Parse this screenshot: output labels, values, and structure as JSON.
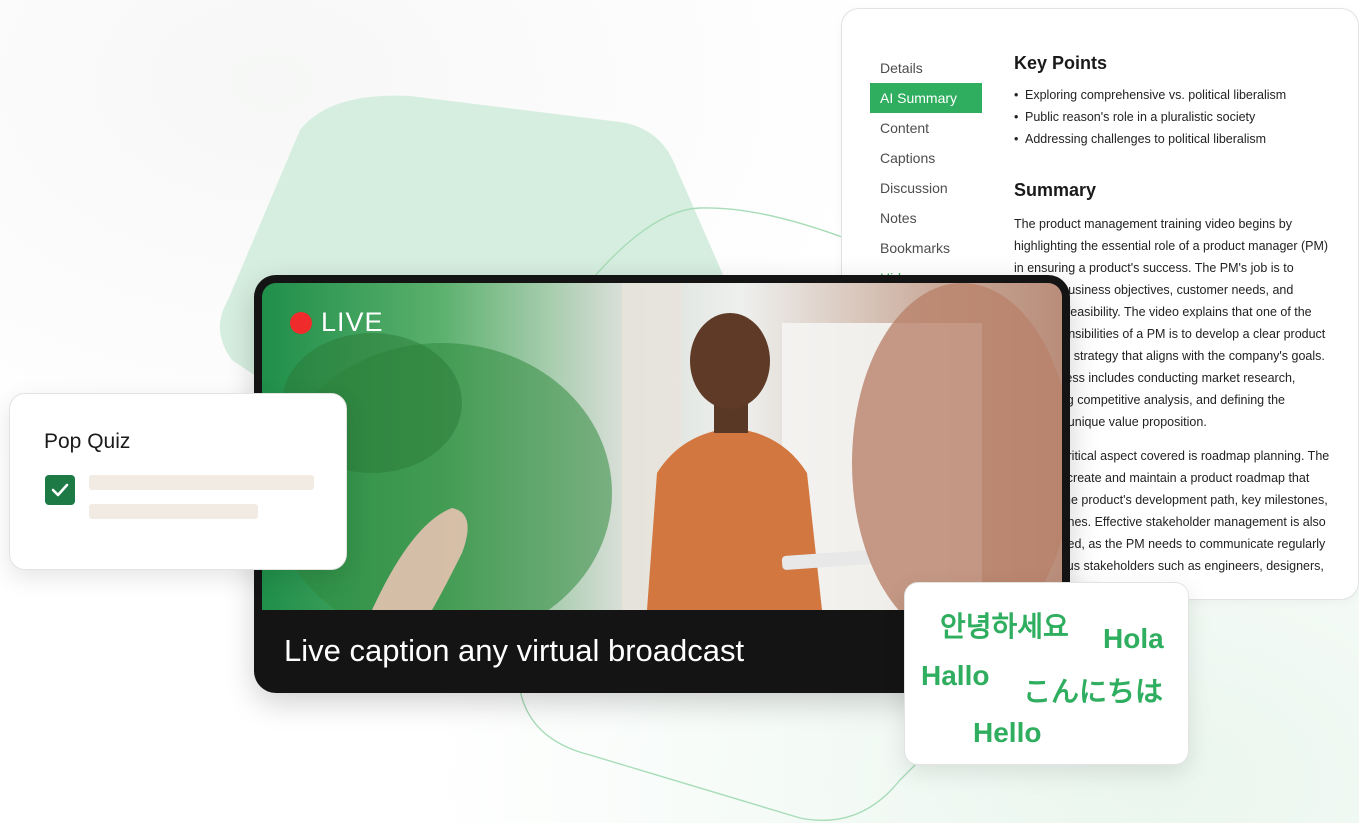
{
  "panel": {
    "tabs": [
      {
        "label": "Details"
      },
      {
        "label": "AI Summary"
      },
      {
        "label": "Content"
      },
      {
        "label": "Captions"
      },
      {
        "label": "Discussion"
      },
      {
        "label": "Notes"
      },
      {
        "label": "Bookmarks"
      },
      {
        "label": "Hide"
      }
    ],
    "active_tab": "AI Summary",
    "key_points_title": "Key Points",
    "key_points": [
      "Exploring comprehensive vs. political liberalism",
      "Public reason's role in a pluralistic society",
      "Addressing challenges to political liberalism"
    ],
    "summary_title": "Summary",
    "summary_paragraphs": [
      "The product management training video begins by highlighting the essential role of a product manager (PM) in ensuring a product's success. The PM's job is to balance business objectives, customer needs, and technical feasibility. The video explains that one of the key responsibilities of a PM is to develop a clear product vision and strategy that aligns with the company's goals. This process includes conducting market research, performing competitive analysis, and defining the product's unique value proposition.",
      "Another critical aspect covered is roadmap planning. The PM must create and maintain a product roadmap that outlines the product's development path, key milestones, and timelines. Effective stakeholder management is also emphasized, as the PM needs to communicate regularly with various stakeholders such as engineers, designers, and customers. This"
    ]
  },
  "video": {
    "live_label": "LIVE",
    "caption": "Live caption any virtual broadcast"
  },
  "quiz": {
    "title": "Pop Quiz"
  },
  "languages": {
    "korean": "안녕하세요",
    "spanish": "Hola",
    "german": "Hallo",
    "japanese": "こんにちは",
    "english": "Hello"
  },
  "colors": {
    "accent": "#2fae5f",
    "live": "#ef2b2b",
    "checkbox": "#1e7a45"
  }
}
